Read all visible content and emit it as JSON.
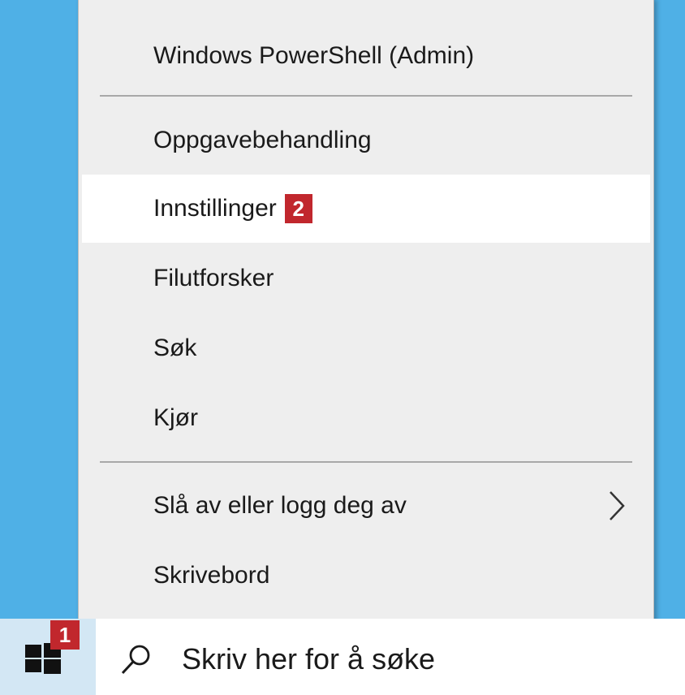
{
  "menu": {
    "items": [
      {
        "label": "Windows PowerShell (Admin)"
      },
      {
        "label": "Oppgavebehandling"
      },
      {
        "label": "Innstillinger",
        "badge": "2"
      },
      {
        "label": "Filutforsker"
      },
      {
        "label": "Søk"
      },
      {
        "label": "Kjør"
      },
      {
        "label": "Slå av eller logg deg av"
      },
      {
        "label": "Skrivebord"
      }
    ]
  },
  "taskbar": {
    "start_badge": "1",
    "search_placeholder": "Skriv her for å søke"
  },
  "icons": {
    "start": "windows-logo-icon",
    "search": "search-icon",
    "submenu": "chevron-right-icon"
  },
  "colors": {
    "desktop": "#4fb0e6",
    "menu_background": "#eeeeee",
    "highlight": "#ffffff",
    "badge": "#c1272d"
  }
}
